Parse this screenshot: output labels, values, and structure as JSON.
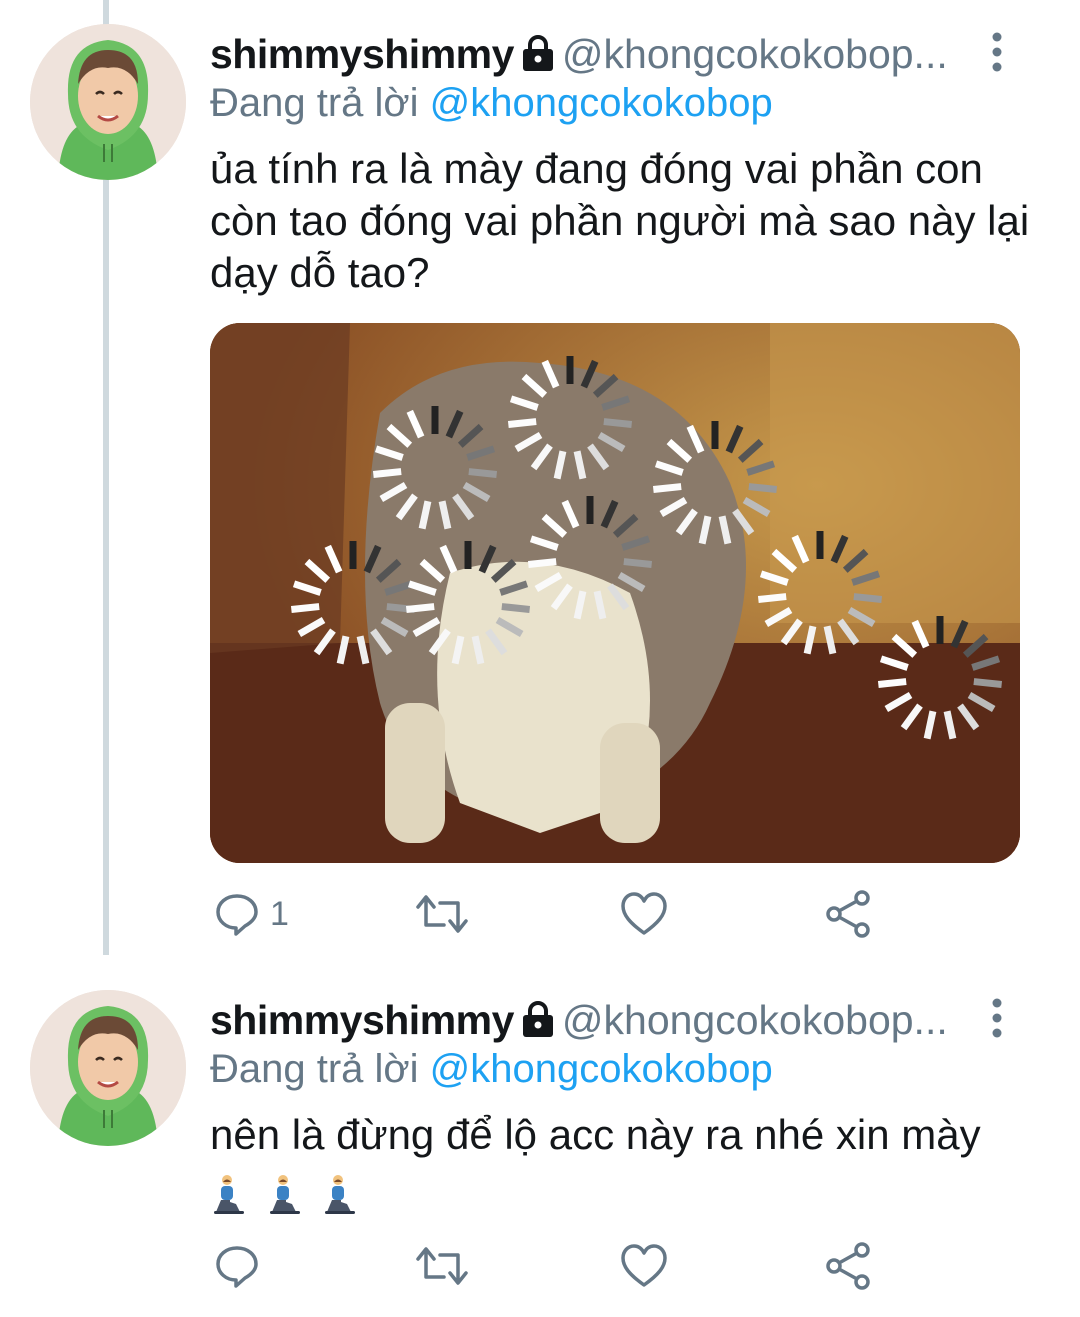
{
  "colors": {
    "text": "#14171a",
    "secondary": "#657786",
    "link": "#1da1f2",
    "thread_line": "#cfd9de"
  },
  "tweets": [
    {
      "display_name": "shimmyshimmy",
      "handle": "@khongcokokobop...",
      "reply_prefix": "Đang trả lời",
      "reply_mention": "@khongcokokobop",
      "text": "ủa tính ra là mày đang đóng vai phần con còn tao đóng vai phần người mà sao này lại dạy dỗ tao?",
      "media": "cat-meme-with-loading-spinners",
      "reply_count": "1",
      "icons": [
        "reply-icon",
        "retweet-icon",
        "like-icon",
        "share-icon",
        "lock-icon",
        "more-icon"
      ]
    },
    {
      "display_name": "shimmyshimmy",
      "handle": "@khongcokokobop...",
      "reply_prefix": "Đang trả lời",
      "reply_mention": "@khongcokokobop",
      "text": "nên là đừng để lộ acc này ra nhé xin mày",
      "emoji": "🧎‍♂️🧎‍♂️🧎‍♂️",
      "reply_count": "",
      "icons": [
        "reply-icon",
        "retweet-icon",
        "like-icon",
        "share-icon",
        "lock-icon",
        "more-icon"
      ]
    }
  ]
}
